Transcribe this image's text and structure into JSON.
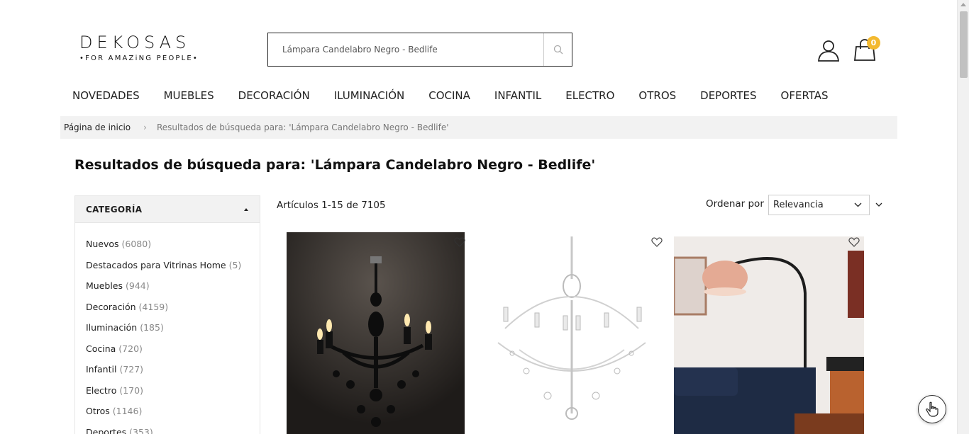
{
  "brand": {
    "name": "DEKOSAS",
    "tagline": "•FOR AMAZiNG PEOPLE•"
  },
  "search": {
    "value": "Lámpara Candelabro Negro - Bedlife",
    "placeholder": ""
  },
  "cart": {
    "count": "0"
  },
  "nav": {
    "items": [
      "NOVEDADES",
      "MUEBLES",
      "DECORACIÓN",
      "ILUMINACIÓN",
      "COCINA",
      "INFANTIL",
      "ELECTRO",
      "OTROS",
      "DEPORTES",
      "OFERTAS"
    ]
  },
  "breadcrumb": {
    "home": "Página de inicio",
    "separator": "›",
    "current": "Resultados de búsqueda para: 'Lámpara Candelabro Negro - Bedlife'"
  },
  "page": {
    "title": "Resultados de búsqueda para: 'Lámpara Candelabro Negro - Bedlife'"
  },
  "sidebar": {
    "heading": "CATEGORÍA",
    "categories": [
      {
        "label": "Nuevos",
        "count": "(6080)"
      },
      {
        "label": "Destacados para Vitrinas Home",
        "count": "(5)"
      },
      {
        "label": "Muebles",
        "count": "(944)"
      },
      {
        "label": "Decoración",
        "count": "(4159)"
      },
      {
        "label": "Iluminación",
        "count": "(185)"
      },
      {
        "label": "Cocina",
        "count": "(720)"
      },
      {
        "label": "Infantil",
        "count": "(727)"
      },
      {
        "label": "Electro",
        "count": "(170)"
      },
      {
        "label": "Otros",
        "count": "(1146)"
      },
      {
        "label": "Deportes",
        "count": "(353)"
      }
    ]
  },
  "toolbar": {
    "count_text": "Artículos 1-15 de 7105",
    "sort_label": "Ordenar por",
    "sort_value": "Relevancia"
  },
  "colors": {
    "badge": "#f3b92f",
    "breadcrumb_bg": "#f2f2f2",
    "sidebar_head_bg": "#f2f2f2"
  },
  "icons": [
    "search-icon",
    "user-icon",
    "cart-icon",
    "heart-icon",
    "chevron-down-icon",
    "hand-pointer-icon"
  ]
}
